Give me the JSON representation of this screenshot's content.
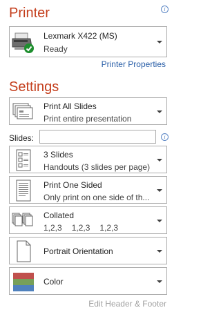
{
  "printer": {
    "heading": "Printer",
    "name": "Lexmark X422 (MS)",
    "status": "Ready",
    "properties_link": "Printer Properties"
  },
  "settings": {
    "heading": "Settings",
    "print_range": {
      "title": "Print All Slides",
      "subtitle": "Print entire presentation"
    },
    "slides_label": "Slides:",
    "slides_value": "",
    "layout": {
      "title": "3 Slides",
      "subtitle": "Handouts (3 slides per page)"
    },
    "sides": {
      "title": "Print One Sided",
      "subtitle": "Only print on one side of th..."
    },
    "collation": {
      "title": "Collated",
      "nums": [
        "1,2,3",
        "1,2,3",
        "1,2,3"
      ]
    },
    "orientation": {
      "title": "Portrait Orientation"
    },
    "color": {
      "title": "Color"
    },
    "footer_link": "Edit Header & Footer"
  },
  "colors": {
    "accent": "#c43e1c",
    "link": "#2a5fa8",
    "border": "#ababab"
  },
  "icons": [
    "info-icon",
    "printer-icon",
    "check-icon",
    "slides-icon",
    "handout-icon",
    "one-sided-icon",
    "collate-icon",
    "portrait-icon",
    "color-swatch-icon"
  ]
}
